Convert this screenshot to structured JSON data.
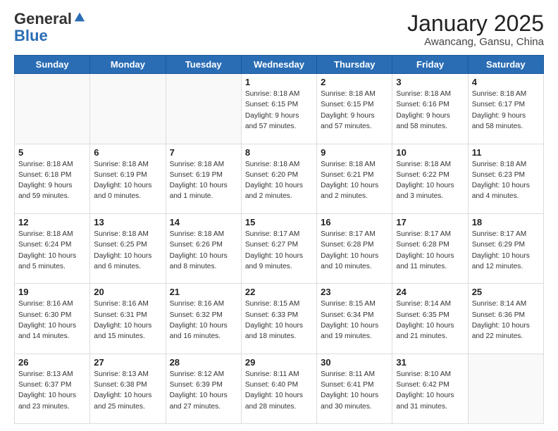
{
  "logo": {
    "general": "General",
    "blue": "Blue"
  },
  "header": {
    "month": "January 2025",
    "location": "Awancang, Gansu, China"
  },
  "days_of_week": [
    "Sunday",
    "Monday",
    "Tuesday",
    "Wednesday",
    "Thursday",
    "Friday",
    "Saturday"
  ],
  "weeks": [
    [
      {
        "day": "",
        "info": ""
      },
      {
        "day": "",
        "info": ""
      },
      {
        "day": "",
        "info": ""
      },
      {
        "day": "1",
        "info": "Sunrise: 8:18 AM\nSunset: 6:15 PM\nDaylight: 9 hours\nand 57 minutes."
      },
      {
        "day": "2",
        "info": "Sunrise: 8:18 AM\nSunset: 6:15 PM\nDaylight: 9 hours\nand 57 minutes."
      },
      {
        "day": "3",
        "info": "Sunrise: 8:18 AM\nSunset: 6:16 PM\nDaylight: 9 hours\nand 58 minutes."
      },
      {
        "day": "4",
        "info": "Sunrise: 8:18 AM\nSunset: 6:17 PM\nDaylight: 9 hours\nand 58 minutes."
      }
    ],
    [
      {
        "day": "5",
        "info": "Sunrise: 8:18 AM\nSunset: 6:18 PM\nDaylight: 9 hours\nand 59 minutes."
      },
      {
        "day": "6",
        "info": "Sunrise: 8:18 AM\nSunset: 6:19 PM\nDaylight: 10 hours\nand 0 minutes."
      },
      {
        "day": "7",
        "info": "Sunrise: 8:18 AM\nSunset: 6:19 PM\nDaylight: 10 hours\nand 1 minute."
      },
      {
        "day": "8",
        "info": "Sunrise: 8:18 AM\nSunset: 6:20 PM\nDaylight: 10 hours\nand 2 minutes."
      },
      {
        "day": "9",
        "info": "Sunrise: 8:18 AM\nSunset: 6:21 PM\nDaylight: 10 hours\nand 2 minutes."
      },
      {
        "day": "10",
        "info": "Sunrise: 8:18 AM\nSunset: 6:22 PM\nDaylight: 10 hours\nand 3 minutes."
      },
      {
        "day": "11",
        "info": "Sunrise: 8:18 AM\nSunset: 6:23 PM\nDaylight: 10 hours\nand 4 minutes."
      }
    ],
    [
      {
        "day": "12",
        "info": "Sunrise: 8:18 AM\nSunset: 6:24 PM\nDaylight: 10 hours\nand 5 minutes."
      },
      {
        "day": "13",
        "info": "Sunrise: 8:18 AM\nSunset: 6:25 PM\nDaylight: 10 hours\nand 6 minutes."
      },
      {
        "day": "14",
        "info": "Sunrise: 8:18 AM\nSunset: 6:26 PM\nDaylight: 10 hours\nand 8 minutes."
      },
      {
        "day": "15",
        "info": "Sunrise: 8:17 AM\nSunset: 6:27 PM\nDaylight: 10 hours\nand 9 minutes."
      },
      {
        "day": "16",
        "info": "Sunrise: 8:17 AM\nSunset: 6:28 PM\nDaylight: 10 hours\nand 10 minutes."
      },
      {
        "day": "17",
        "info": "Sunrise: 8:17 AM\nSunset: 6:28 PM\nDaylight: 10 hours\nand 11 minutes."
      },
      {
        "day": "18",
        "info": "Sunrise: 8:17 AM\nSunset: 6:29 PM\nDaylight: 10 hours\nand 12 minutes."
      }
    ],
    [
      {
        "day": "19",
        "info": "Sunrise: 8:16 AM\nSunset: 6:30 PM\nDaylight: 10 hours\nand 14 minutes."
      },
      {
        "day": "20",
        "info": "Sunrise: 8:16 AM\nSunset: 6:31 PM\nDaylight: 10 hours\nand 15 minutes."
      },
      {
        "day": "21",
        "info": "Sunrise: 8:16 AM\nSunset: 6:32 PM\nDaylight: 10 hours\nand 16 minutes."
      },
      {
        "day": "22",
        "info": "Sunrise: 8:15 AM\nSunset: 6:33 PM\nDaylight: 10 hours\nand 18 minutes."
      },
      {
        "day": "23",
        "info": "Sunrise: 8:15 AM\nSunset: 6:34 PM\nDaylight: 10 hours\nand 19 minutes."
      },
      {
        "day": "24",
        "info": "Sunrise: 8:14 AM\nSunset: 6:35 PM\nDaylight: 10 hours\nand 21 minutes."
      },
      {
        "day": "25",
        "info": "Sunrise: 8:14 AM\nSunset: 6:36 PM\nDaylight: 10 hours\nand 22 minutes."
      }
    ],
    [
      {
        "day": "26",
        "info": "Sunrise: 8:13 AM\nSunset: 6:37 PM\nDaylight: 10 hours\nand 23 minutes."
      },
      {
        "day": "27",
        "info": "Sunrise: 8:13 AM\nSunset: 6:38 PM\nDaylight: 10 hours\nand 25 minutes."
      },
      {
        "day": "28",
        "info": "Sunrise: 8:12 AM\nSunset: 6:39 PM\nDaylight: 10 hours\nand 27 minutes."
      },
      {
        "day": "29",
        "info": "Sunrise: 8:11 AM\nSunset: 6:40 PM\nDaylight: 10 hours\nand 28 minutes."
      },
      {
        "day": "30",
        "info": "Sunrise: 8:11 AM\nSunset: 6:41 PM\nDaylight: 10 hours\nand 30 minutes."
      },
      {
        "day": "31",
        "info": "Sunrise: 8:10 AM\nSunset: 6:42 PM\nDaylight: 10 hours\nand 31 minutes."
      },
      {
        "day": "",
        "info": ""
      }
    ]
  ]
}
